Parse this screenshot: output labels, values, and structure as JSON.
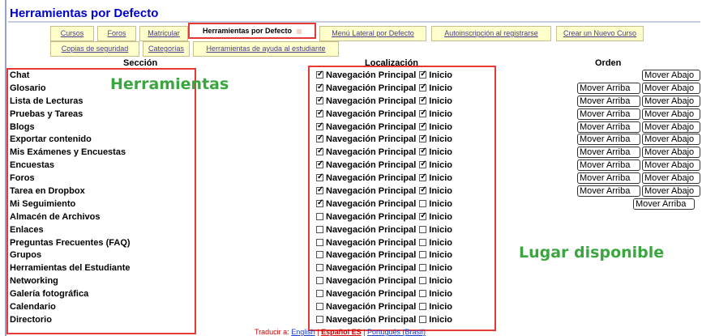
{
  "title": "Herramientas por Defecto",
  "tabs_row1": [
    "Cursos",
    "Foros",
    "Matricular",
    "Herramientas por Defecto",
    "Menú Lateral por Defecto",
    "Autoinscripción al registrarse",
    "Crear un Nuevo Curso"
  ],
  "tabs_row2": [
    "Copias de seguridad",
    "Categorías",
    "Herramientas de ayuda al estudiante"
  ],
  "headers": {
    "section": "Sección",
    "location": "Localización",
    "order": "Orden"
  },
  "labels": {
    "main_nav": "Navegación Principal",
    "home": "Inicio",
    "move_up": "Mover Arriba",
    "move_down": "Mover Abajo"
  },
  "rows": [
    {
      "name": "Chat",
      "nav": true,
      "home": true,
      "up": false,
      "down": true
    },
    {
      "name": "Glosario",
      "nav": true,
      "home": true,
      "up": true,
      "down": true
    },
    {
      "name": "Lista de Lecturas",
      "nav": true,
      "home": true,
      "up": true,
      "down": true
    },
    {
      "name": "Pruebas y Tareas",
      "nav": true,
      "home": true,
      "up": true,
      "down": true
    },
    {
      "name": "Blogs",
      "nav": true,
      "home": true,
      "up": true,
      "down": true
    },
    {
      "name": "Exportar contenido",
      "nav": true,
      "home": true,
      "up": true,
      "down": true
    },
    {
      "name": "Mis Exámenes y Encuestas",
      "nav": true,
      "home": true,
      "up": true,
      "down": true
    },
    {
      "name": "Encuestas",
      "nav": true,
      "home": true,
      "up": true,
      "down": true
    },
    {
      "name": "Foros",
      "nav": true,
      "home": true,
      "up": true,
      "down": true
    },
    {
      "name": "Tarea en Dropbox",
      "nav": true,
      "home": true,
      "up": true,
      "down": true
    },
    {
      "name": "Mi Seguimiento",
      "nav": true,
      "home": false,
      "up": true,
      "down": false
    },
    {
      "name": "Almacén de Archivos",
      "nav": false,
      "home": true,
      "up": false,
      "down": false
    },
    {
      "name": "Enlaces",
      "nav": false,
      "home": false,
      "up": false,
      "down": false
    },
    {
      "name": "Preguntas Frecuentes (FAQ)",
      "nav": false,
      "home": false,
      "up": false,
      "down": false
    },
    {
      "name": "Grupos",
      "nav": false,
      "home": false,
      "up": false,
      "down": false
    },
    {
      "name": "Herramientas del Estudiante",
      "nav": false,
      "home": false,
      "up": false,
      "down": false
    },
    {
      "name": "Networking",
      "nav": false,
      "home": false,
      "up": false,
      "down": false
    },
    {
      "name": "Galería fotográfica",
      "nav": false,
      "home": false,
      "up": false,
      "down": false
    },
    {
      "name": "Calendario",
      "nav": false,
      "home": false,
      "up": false,
      "down": false
    },
    {
      "name": "Directorio",
      "nav": false,
      "home": false,
      "up": false,
      "down": false
    }
  ],
  "annotations": {
    "tools": "Herramientas",
    "available": "Lugar disponible"
  },
  "footer": {
    "prefix": "Traducir a:",
    "english": "English",
    "spanish": "Español ES",
    "portuguese": "Português (Brasil)"
  },
  "colors": {
    "title": "#0000cc",
    "tab_bg": "#ffffcc",
    "highlight_red": "#e53935",
    "annotation_green": "#3aa640"
  }
}
